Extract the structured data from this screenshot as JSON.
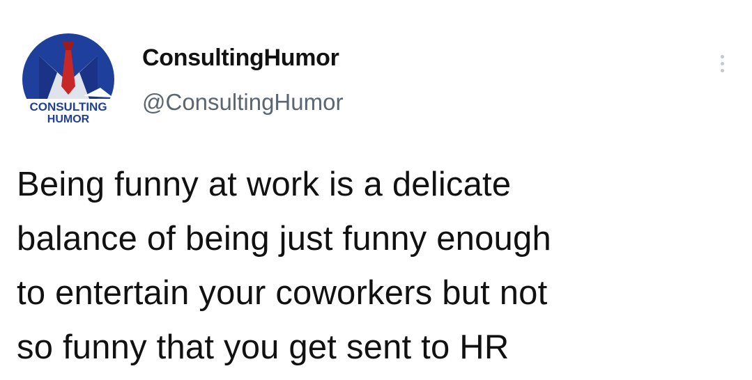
{
  "tweet": {
    "author": {
      "display_name": "ConsultingHumor",
      "handle": "@ConsultingHumor",
      "avatar": {
        "text_line1": "CONSULTING",
        "text_line2": "HUMOR",
        "colors": {
          "circle": "#1f3f9c",
          "shirt": "#dfe3ec",
          "tie": "#c62828",
          "banner": "#ffffff"
        }
      }
    },
    "menu_icon": "more-vertical-icon",
    "text_lines": [
      "Being funny at work is a delicate",
      "balance of being just funny enough",
      "to entertain your coworkers but not",
      "so funny that you get sent to HR"
    ]
  }
}
